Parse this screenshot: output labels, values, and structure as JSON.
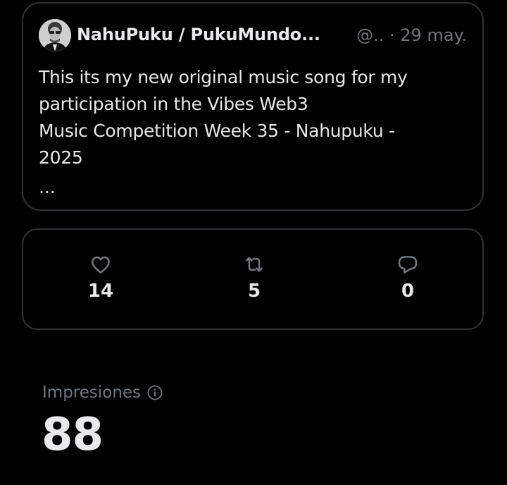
{
  "tweet": {
    "author_name": "NahuPuku / PukuMundo...",
    "handle": "@..",
    "separator": "·",
    "date": "29 may.",
    "text": "This its my new original music song for my\nparticipation in the Vibes Web3\nMusic Competition Week 35 - Nahupuku -\n2025",
    "truncation": "..."
  },
  "stats": {
    "likes": {
      "icon": "heart-icon",
      "count": "14"
    },
    "reposts": {
      "icon": "repost-icon",
      "count": "5"
    },
    "replies": {
      "icon": "reply-icon",
      "count": "0"
    }
  },
  "impressions": {
    "label": "Impresiones",
    "value": "88"
  },
  "colors": {
    "background": "#000000",
    "border": "#2f3336",
    "primary_text": "#e7e9ea",
    "secondary_text": "#71767b"
  }
}
